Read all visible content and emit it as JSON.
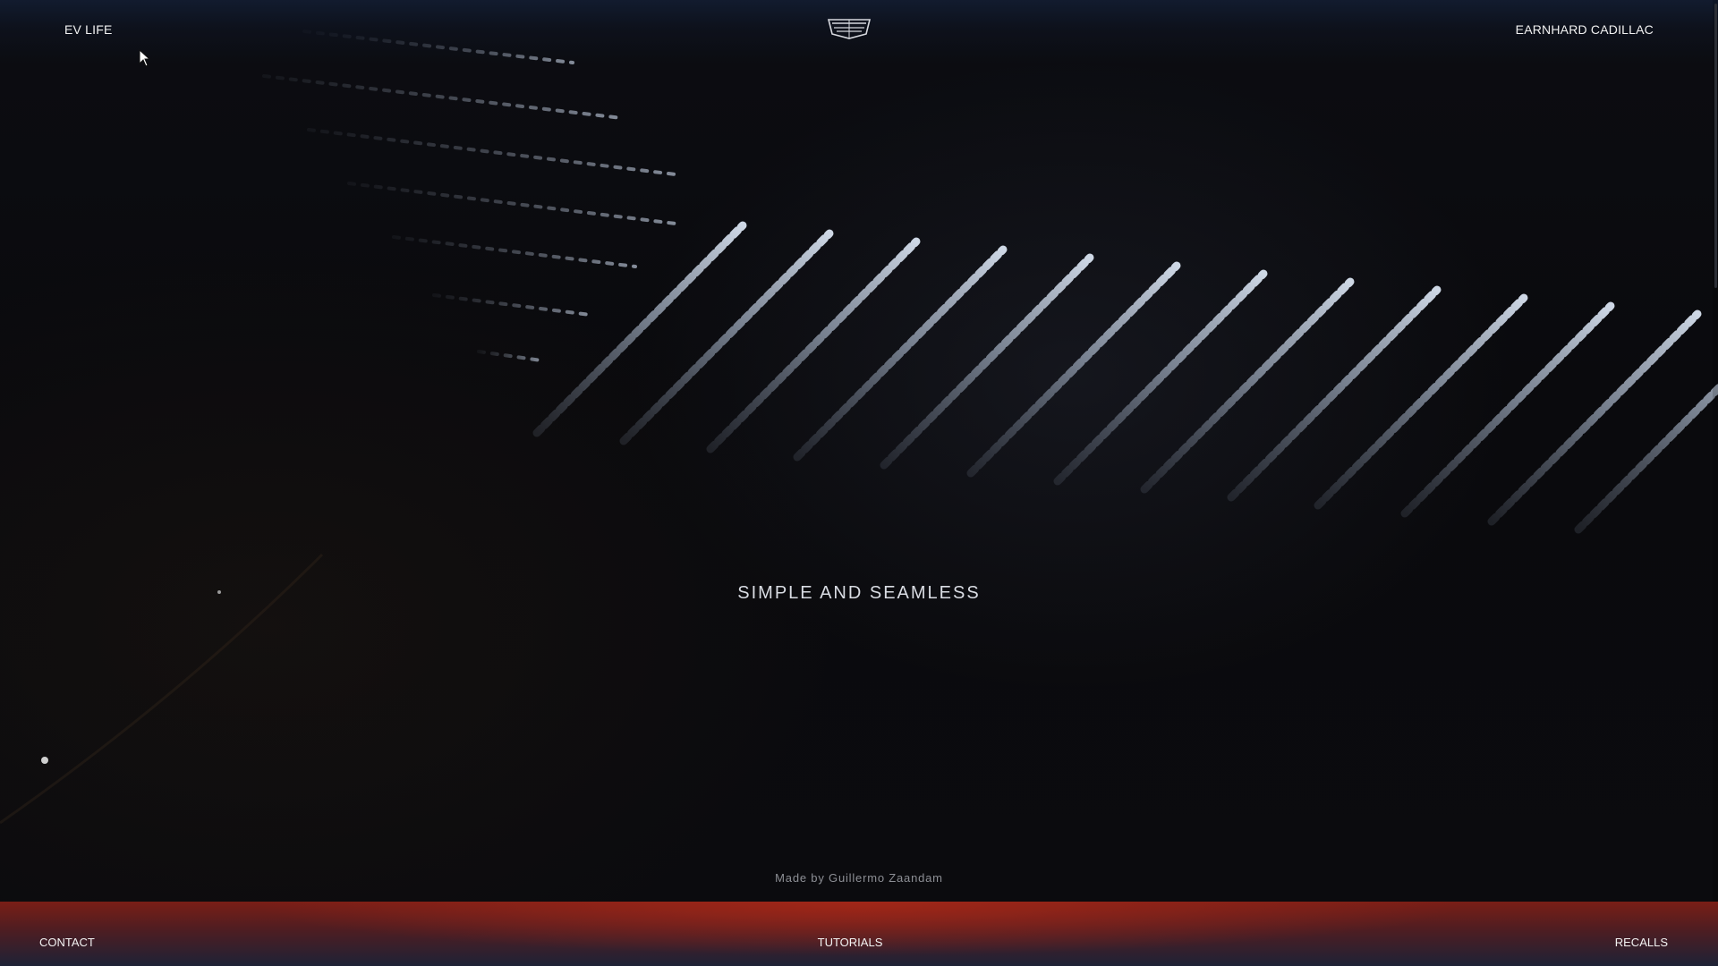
{
  "header": {
    "left_link": "EV LIFE",
    "logo_icon": "cadillac-crest-icon",
    "right_link": "EARNHARD CADILLAC"
  },
  "hero": {
    "headline": "SIMPLE AND SEAMLESS",
    "credit": "Made by Guillermo Zaandam"
  },
  "footer": {
    "contact": "CONTACT",
    "tutorials": "TUTORIALS",
    "recalls": "RECALLS"
  },
  "colors": {
    "accent_red": "#8a2216",
    "header_blue": "#121c30",
    "text": "#f2f2f2"
  }
}
